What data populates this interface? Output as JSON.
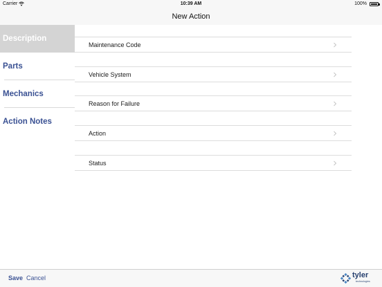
{
  "status_bar": {
    "carrier": "Carrier",
    "time": "10:39 AM",
    "battery": "100%"
  },
  "nav": {
    "title": "New Action"
  },
  "sidebar": {
    "items": [
      {
        "label": "Description",
        "active": true
      },
      {
        "label": "Parts",
        "active": false
      },
      {
        "label": "Mechanics",
        "active": false
      },
      {
        "label": "Action Notes",
        "active": false
      }
    ]
  },
  "form": {
    "rows": [
      {
        "label": "Maintenance Code"
      },
      {
        "label": "Vehicle System"
      },
      {
        "label": "Reason for Failure"
      },
      {
        "label": "Action"
      },
      {
        "label": "Status"
      }
    ]
  },
  "toolbar": {
    "save_label": "Save",
    "cancel_label": "Cancel",
    "logo_word": "tyler",
    "logo_sub": "technologies"
  },
  "colors": {
    "accent": "#3a5193",
    "active_bg": "#d4d4d4",
    "bar_bg": "#f7f7f7"
  },
  "icons": [
    "wifi-icon",
    "battery-icon",
    "chevron-right-icon",
    "tyler-logo-icon"
  ]
}
